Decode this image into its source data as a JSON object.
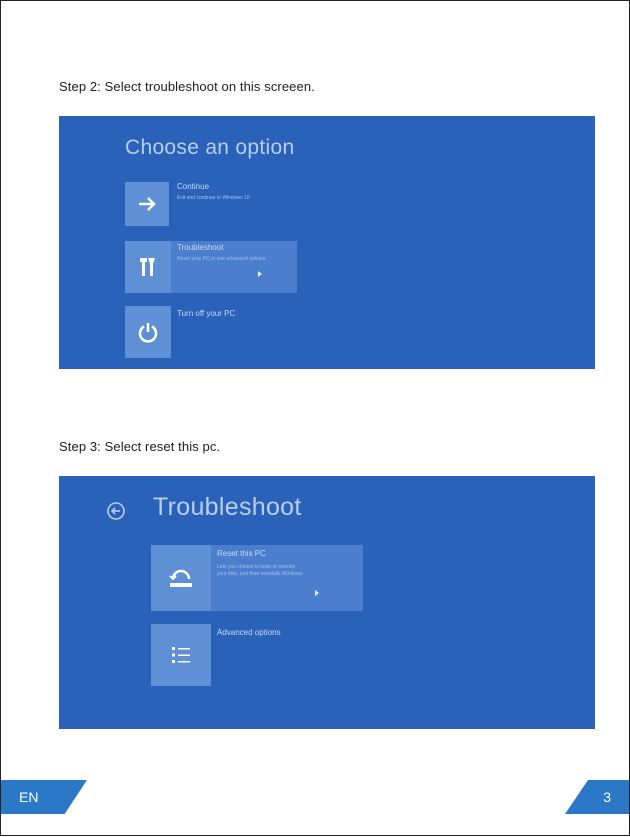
{
  "step2": {
    "caption": "Step 2: Select troubleshoot on this screeen.",
    "screen": {
      "title": "Choose an option",
      "options": [
        {
          "title": "Continue",
          "description": "Exit and continue to Windows 10",
          "icon": "arrow-right-icon"
        },
        {
          "title": "Troubleshoot",
          "description": "Reset your PC or see advanced options",
          "icon": "tools-icon"
        },
        {
          "title": "Turn off your PC",
          "description": "",
          "icon": "power-icon"
        }
      ]
    }
  },
  "step3": {
    "caption": "Step 3: Select reset this pc.",
    "screen": {
      "title": "Troubleshoot",
      "back_icon": "back-arrow-icon",
      "options": [
        {
          "title": "Reset this PC",
          "description_lines": [
            "Lets you choose to keep or remove",
            "your files, and then reinstalls Windows."
          ],
          "icon": "reset-pc-icon"
        },
        {
          "title": "Advanced options",
          "icon": "checklist-icon"
        }
      ]
    }
  },
  "footer": {
    "language": "EN",
    "page_number": "3"
  },
  "colors": {
    "screen_background": "#2a62ba",
    "tile": "#5f8fd4",
    "badge": "#2b78c6"
  }
}
